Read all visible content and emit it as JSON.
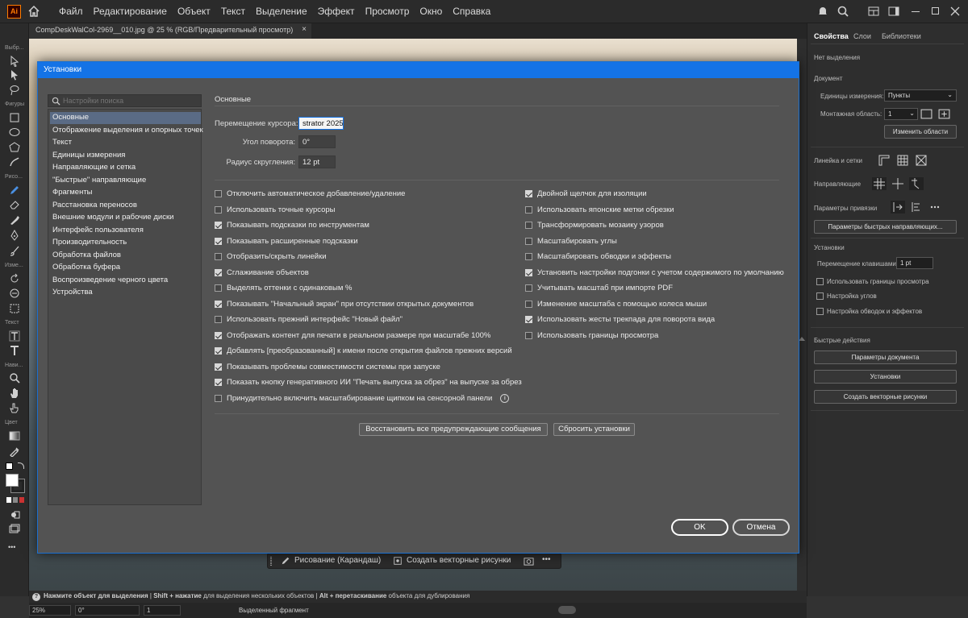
{
  "app": {
    "logo": "Ai",
    "menus": [
      "Файл",
      "Редактирование",
      "Объект",
      "Текст",
      "Выделение",
      "Эффект",
      "Просмотр",
      "Окно",
      "Справка"
    ]
  },
  "document": {
    "tab_title": "CompDeskWalCol-2969__010.jpg @ 25 % (RGB/Предварительный просмотр)",
    "close": "×"
  },
  "toolbar": {
    "labels": [
      "Выбр...",
      "Фигуры",
      "Рисо...",
      "Изме...",
      "Текст",
      "Нави...",
      "Цвет"
    ],
    "more": "•••"
  },
  "right_panel": {
    "tabs": [
      "Свойства",
      "Слои",
      "Библиотеки"
    ],
    "no_selection": "Нет выделения",
    "document_heading": "Документ",
    "units_label": "Единицы измерения:",
    "units_value": "Пункты",
    "artboard_label": "Монтажная область:",
    "artboard_value": "1",
    "edit_artboards": "Изменить области",
    "rulers_label": "Линейка и сетки",
    "guides_label": "Направляющие",
    "snap_label": "Параметры привязки",
    "smart_guides_btn": "Параметры быстрых направляющих...",
    "prefs_heading": "Установки",
    "key_incr_label": "Перемещение клавишами:",
    "key_incr_value": "1 pt",
    "checks": [
      "Использовать границы просмотра",
      "Настройка углов",
      "Настройка обводок и эффектов"
    ],
    "quick_actions": "Быстрые действия",
    "qa_buttons": [
      "Параметры документа",
      "Установки",
      "Создать векторные рисунки"
    ]
  },
  "context_bar": {
    "draw": "Рисование (Карандаш)",
    "vectorize": "Создать векторные рисунки",
    "more": "•••"
  },
  "status": {
    "hint_bold1": "Нажмите объект для выделения",
    "sep": "|",
    "hint_bold2": "Shift + нажатие",
    "hint2": "для выделения нескольких объектов",
    "hint_bold3": "Alt + перетаскивание",
    "hint3": "объекта для дублирования",
    "zoom": "25%",
    "rotate": "0°",
    "artboard": "1",
    "selection_tool": "Выделенный фрагмент"
  },
  "dialog": {
    "title": "Установки",
    "search_placeholder": "Настройки поиска",
    "nav": [
      "Основные",
      "Отображение выделения и опорных точек",
      "Текст",
      "Единицы измерения",
      "Направляющие и сетка",
      "\"Быстрые\" направляющие",
      "Фрагменты",
      "Расстановка переносов",
      "Внешние модули и рабочие диски",
      "Интерфейс пользователя",
      "Производительность",
      "Обработка файлов",
      "Обработка буфера",
      "Воспроизведение черного цвета",
      "Устройства"
    ],
    "selected_nav": 0,
    "section": "Основные",
    "keyboard_increment_label": "Перемещение курсора:",
    "keyboard_increment_value": "strator 2025",
    "constrain_angle_label": "Угол поворота:",
    "constrain_angle_value": "0°",
    "corner_radius_label": "Радиус скругления:",
    "corner_radius_value": "12 pt",
    "left_checks": [
      {
        "label": "Отключить автоматическое добавление/удаление",
        "checked": false
      },
      {
        "label": "Использовать точные курсоры",
        "checked": false
      },
      {
        "label": "Показывать подсказки по инструментам",
        "checked": true
      },
      {
        "label": "Показывать расширенные подсказки",
        "checked": true
      },
      {
        "label": "Отобразить/скрыть линейки",
        "checked": false
      },
      {
        "label": "Сглаживание объектов",
        "checked": true
      },
      {
        "label": "Выделять оттенки с одинаковым %",
        "checked": false
      },
      {
        "label": "Показывать \"Начальный экран\" при отсутствии открытых документов",
        "checked": true
      },
      {
        "label": "Использовать прежний интерфейс \"Новый файл\"",
        "checked": false
      },
      {
        "label": "Отображать контент для печати в реальном размере при масштабе 100%",
        "checked": true
      },
      {
        "label": "Добавлять [преобразованный] к имени после открытия файлов прежних версий",
        "checked": true
      },
      {
        "label": "Показывать проблемы совместимости системы при запуске",
        "checked": true
      },
      {
        "label": "Показать кнопку генеративного ИИ \"Печать выпуска за обрез\" на выпуске за обрез",
        "checked": true
      },
      {
        "label": "Принудительно включить масштабирование щипком на сенсорной панели",
        "checked": false
      }
    ],
    "right_checks": [
      {
        "label": "Двойной щелчок для изоляции",
        "checked": true
      },
      {
        "label": "Использовать японские метки обрезки",
        "checked": false
      },
      {
        "label": "Трансформировать мозаику узоров",
        "checked": false
      },
      {
        "label": "Масштабировать углы",
        "checked": false
      },
      {
        "label": "Масштабировать обводки и эффекты",
        "checked": false
      },
      {
        "label": "Установить настройки подгонки с учетом содержимого по умолчанию",
        "checked": true
      },
      {
        "label": "Учитывать масштаб при импорте PDF",
        "checked": false
      },
      {
        "label": "Изменение масштаба с помощью колеса мыши",
        "checked": false
      },
      {
        "label": "Использовать жесты трекпада для поворота вида",
        "checked": true
      },
      {
        "label": "Использовать границы просмотра",
        "checked": false
      }
    ],
    "info_symbol": "i",
    "reset_warnings": "Восстановить все предупреждающие сообщения",
    "reset_prefs": "Сбросить установки",
    "ok": "OK",
    "cancel": "Отмена"
  }
}
